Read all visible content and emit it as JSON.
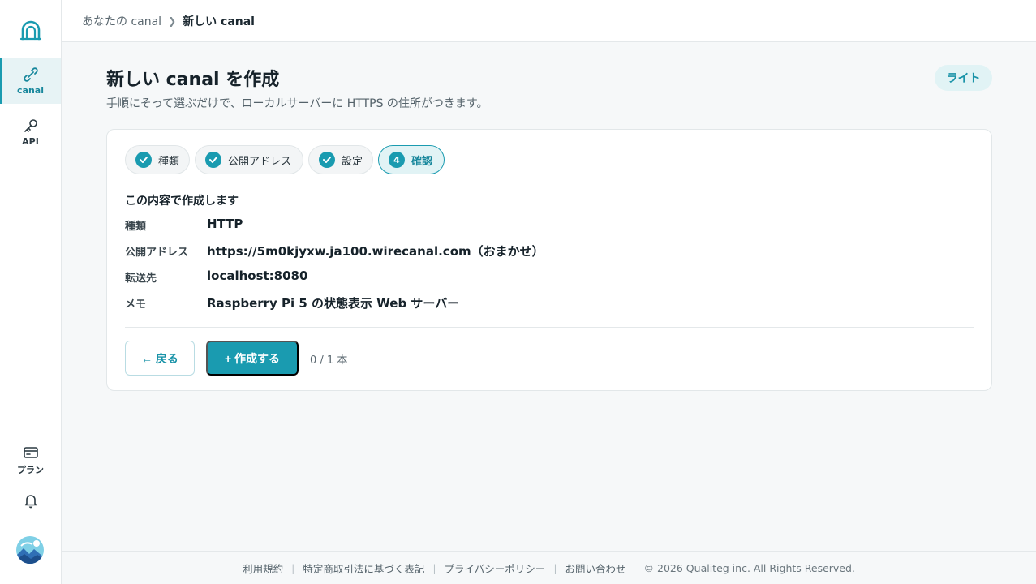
{
  "colors": {
    "accent": "#1a9bb0",
    "accent_soft": "#e1f3f5",
    "text": "#16222a",
    "muted": "#55636b"
  },
  "sidebar": {
    "items": [
      {
        "label": "canal",
        "icon": "link-plug-icon",
        "active": true
      },
      {
        "label": "API",
        "icon": "key-icon"
      },
      {
        "label": "プラン",
        "icon": "card-icon"
      }
    ],
    "bell_icon": "bell-icon",
    "logo_icon": "tunnel-arch-icon"
  },
  "breadcrumb": {
    "parent": "あなたの canal",
    "current": "新しい canal"
  },
  "header": {
    "title": "新しい canal を作成",
    "subtitle": "手順にそって選ぶだけで、ローカルサーバーに HTTPS の住所がつきます。",
    "theme_label": "ライト"
  },
  "steps": [
    {
      "label": "種類",
      "state": "done"
    },
    {
      "label": "公開アドレス",
      "state": "done"
    },
    {
      "label": "設定",
      "state": "done"
    },
    {
      "label": "確認",
      "number": "4",
      "state": "current"
    }
  ],
  "confirm": {
    "title": "この内容で作成します",
    "rows": [
      {
        "label": "種類",
        "value": "HTTP"
      },
      {
        "label": "公開アドレス",
        "value": "https://5m0kjyxw.ja100.wirecanal.com（おまかせ）"
      },
      {
        "label": "転送先",
        "value": "localhost:8080"
      },
      {
        "label": "メモ",
        "value": "Raspberry Pi 5 の状態表示 Web サーバー"
      }
    ]
  },
  "actions": {
    "back_label": "← 戻る",
    "create_label": "+ 作成する",
    "quota": "0 / 1 本"
  },
  "footer": {
    "links": [
      "利用規約",
      "特定商取引法に基づく表記",
      "プライバシーポリシー",
      "お問い合わせ"
    ],
    "copyright": "© 2026 Qualiteg inc. All Rights Reserved."
  }
}
